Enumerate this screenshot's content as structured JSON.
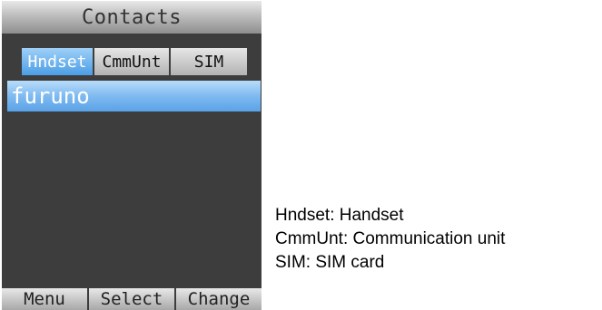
{
  "screen": {
    "title": "Contacts",
    "tabs": [
      {
        "label": "Hndset",
        "active": true
      },
      {
        "label": "CmmUnt",
        "active": false
      },
      {
        "label": "SIM",
        "active": false
      }
    ],
    "contacts": [
      {
        "name": "furuno",
        "selected": true
      }
    ],
    "softkeys": [
      "Menu",
      "Select",
      "Change"
    ]
  },
  "legend": [
    "Hndset: Handset",
    "CmmUnt: Communication unit",
    "SIM: SIM card"
  ],
  "colors": {
    "screen_bg": "#3d3d3d",
    "selection": "#5aa2e8",
    "active_tab": "#4b9ee6"
  }
}
